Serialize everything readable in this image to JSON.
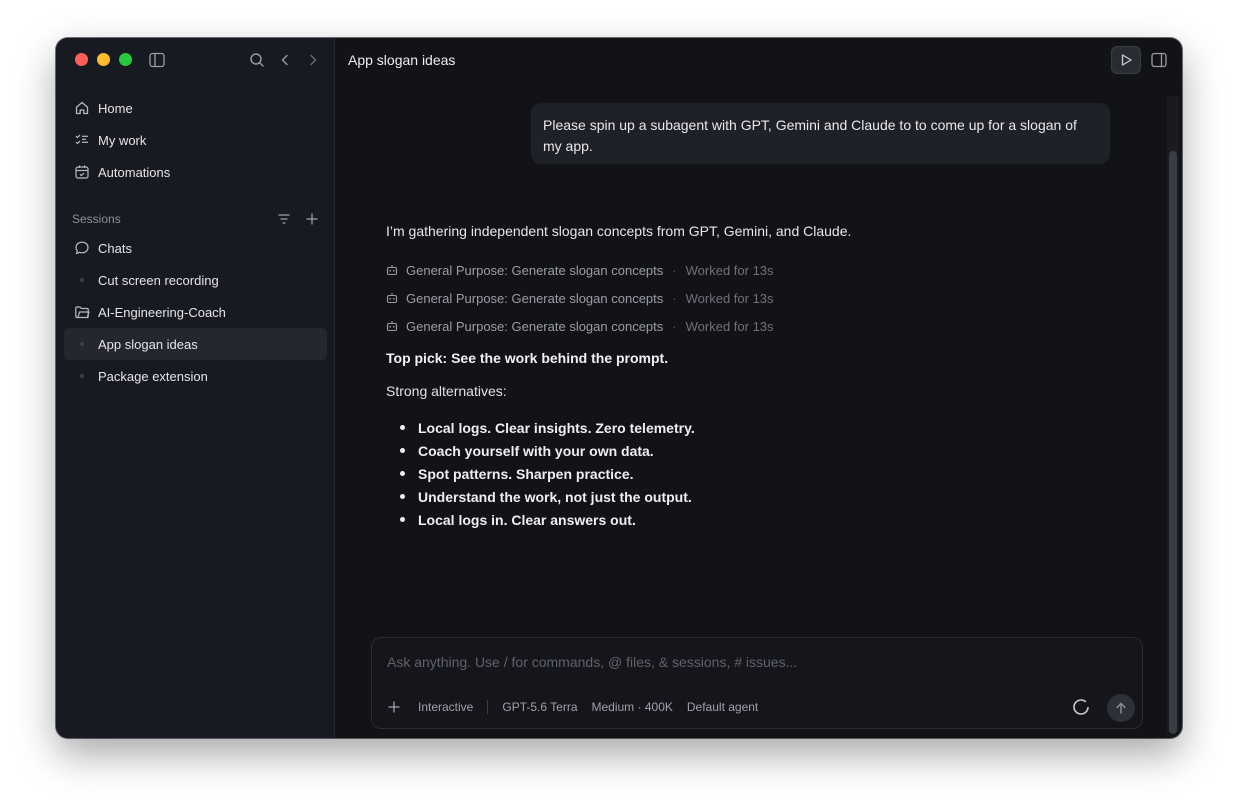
{
  "sidebar": {
    "nav": [
      {
        "label": "Home",
        "icon": "home-icon"
      },
      {
        "label": "My work",
        "icon": "checklist-icon"
      },
      {
        "label": "Automations",
        "icon": "calendar-icon"
      }
    ],
    "sessions_label": "Sessions",
    "sessions": [
      {
        "label": "Chats",
        "icon": "chat-bubble-icon"
      },
      {
        "label": "Cut screen recording",
        "icon": "dot"
      },
      {
        "label": "AI-Engineering-Coach",
        "icon": "folder-icon"
      },
      {
        "label": "App slogan ideas",
        "icon": "dot",
        "active": true
      },
      {
        "label": "Package extension",
        "icon": "dot"
      }
    ]
  },
  "main": {
    "title": "App slogan ideas",
    "user_message": "Please spin up a subagent with GPT, Gemini and Claude to to come up for a slogan of my app.",
    "assistant": {
      "intro": "I’m gathering independent slogan concepts from GPT, Gemini, and Claude.",
      "agents": [
        {
          "label": "General Purpose: Generate slogan concepts",
          "separator": "·",
          "status": "Worked for 13s"
        },
        {
          "label": "General Purpose: Generate slogan concepts",
          "separator": "·",
          "status": "Worked for 13s"
        },
        {
          "label": "General Purpose: Generate slogan concepts",
          "separator": "·",
          "status": "Worked for 13s"
        }
      ],
      "top_pick": "Top pick: See the work behind the prompt.",
      "alternatives_label": "Strong alternatives:",
      "alternatives": [
        "Local logs. Clear insights. Zero telemetry.",
        "Coach yourself with your own data.",
        "Spot patterns. Sharpen practice.",
        "Understand the work, not just the output.",
        "Local logs in. Clear answers out."
      ]
    },
    "composer": {
      "placeholder": "Ask anything. Use / for commands, @ files, & sessions, # issues...",
      "value": "",
      "mode": "Interactive",
      "model": "GPT-5.6 Terra",
      "effort": "Medium · 400K",
      "agent": "Default agent"
    }
  },
  "colors": {
    "background": "#121317",
    "sidebar": "#181a21",
    "active_item": "#252730",
    "traffic_red": "#ff5f57",
    "traffic_yellow": "#febc2e",
    "traffic_green": "#28c840"
  }
}
